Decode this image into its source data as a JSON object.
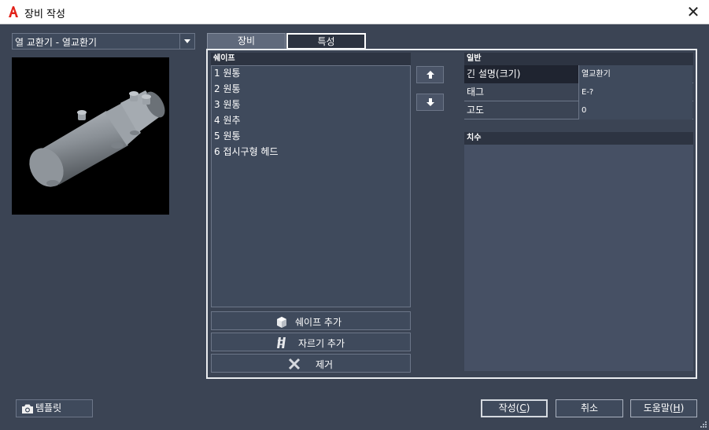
{
  "window": {
    "title": "장비 작성",
    "close_glyph": "✕"
  },
  "equipment_selector": {
    "value": "열 교환기 - 열교환기"
  },
  "tabs": [
    {
      "label": "장비"
    },
    {
      "label": "특성"
    }
  ],
  "shapes": {
    "header": "쉐이프",
    "items": [
      "1 원통",
      "2 원통",
      "3 원통",
      "4 원추",
      "5 원통",
      "6 접시구형 헤드"
    ],
    "add_shape_label": "쉐이프 추가",
    "add_cut_label": "자르기 추가",
    "remove_label": "제거"
  },
  "general": {
    "header": "일반",
    "rows": [
      {
        "key": "긴 설명(크기)",
        "value": "열교환기"
      },
      {
        "key": "태그",
        "value": "E-?"
      },
      {
        "key": "고도",
        "value": "0"
      }
    ]
  },
  "dimensions": {
    "header": "치수"
  },
  "footer": {
    "template_label": "템플릿",
    "create_label": "작성(",
    "create_key": "C",
    "cancel_label": "취소",
    "help_label": "도움말(",
    "help_key": "H",
    "close_paren": ")"
  },
  "icons": {
    "app": "autocad-a-icon",
    "move_up": "arrow-up-icon",
    "move_down": "arrow-down-icon",
    "add_shape": "cube-icon",
    "add_cut": "cut-icon",
    "remove": "x-icon",
    "template": "camera-icon"
  },
  "colors": {
    "background": "#3b4454",
    "app_icon": "#e2231a"
  }
}
